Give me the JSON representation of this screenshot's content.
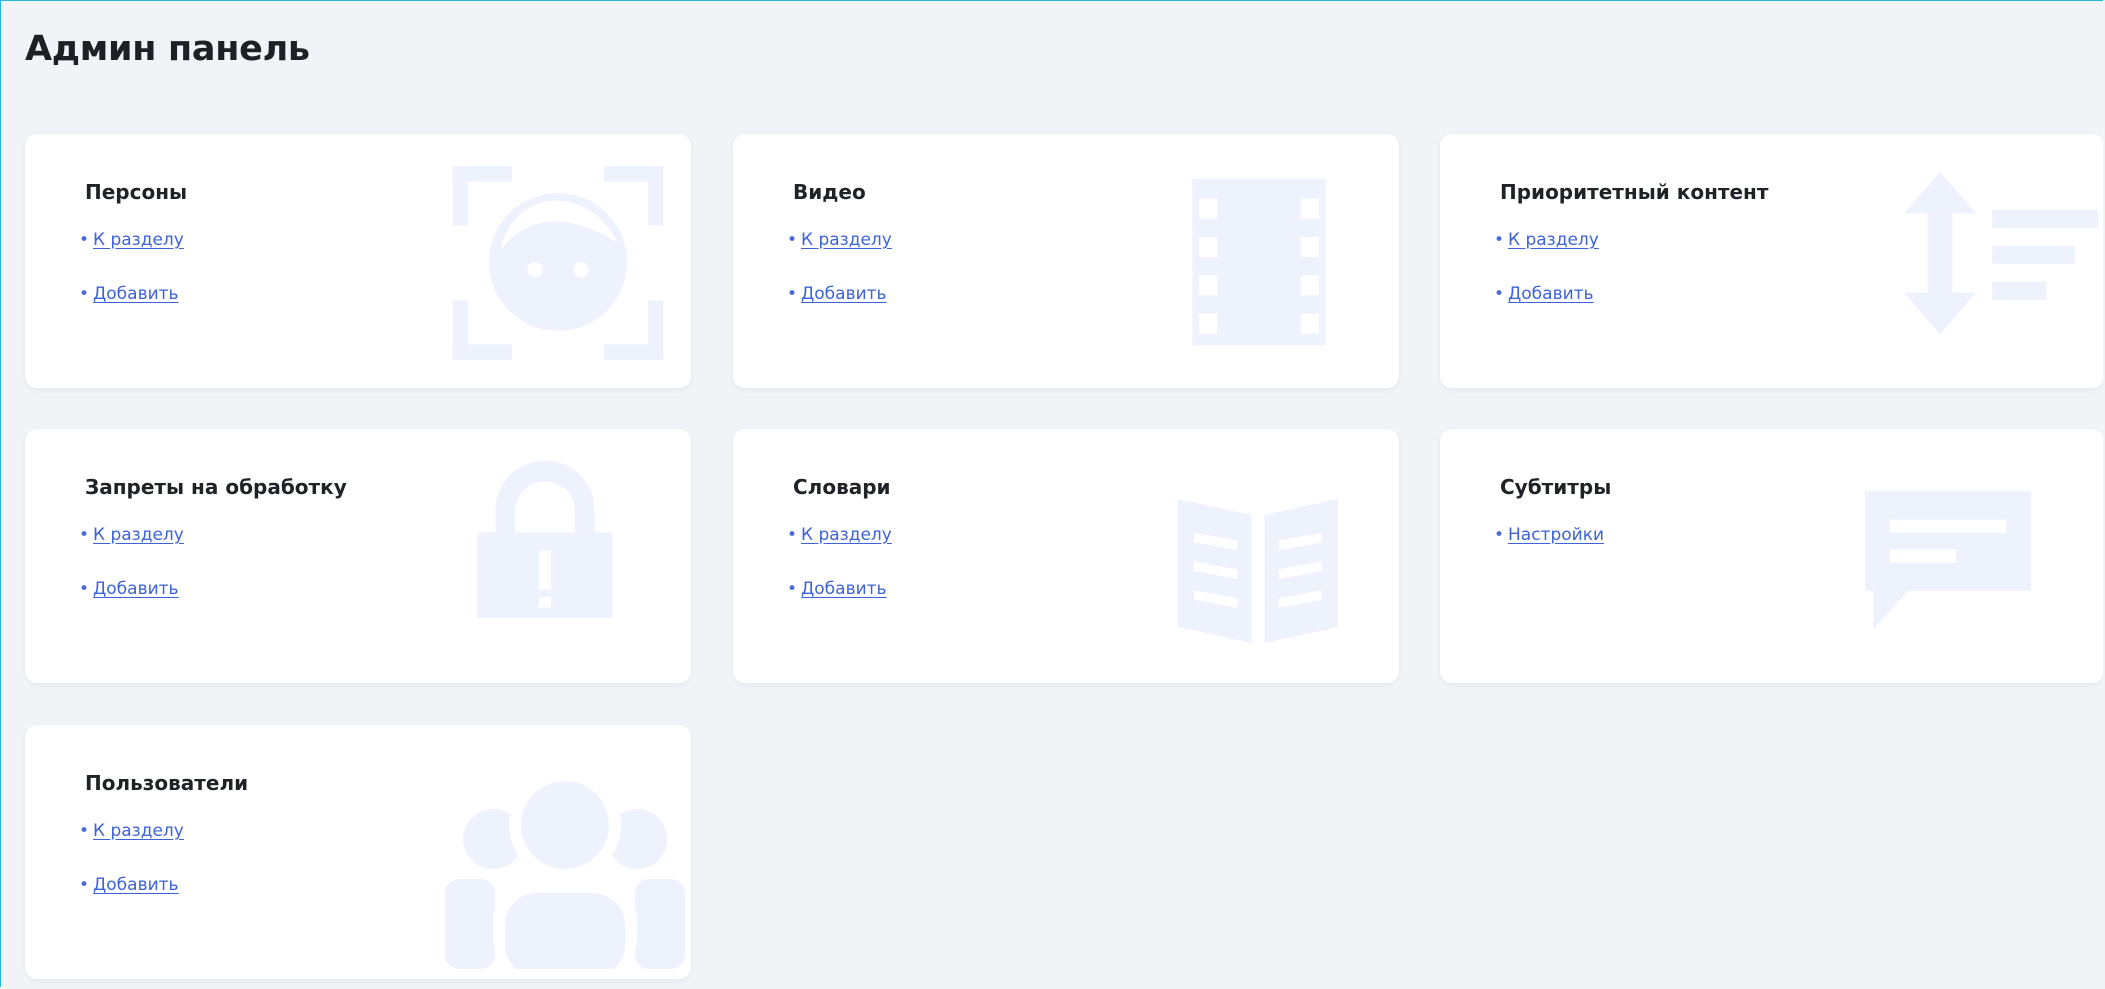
{
  "page": {
    "title": "Админ панель"
  },
  "colors": {
    "accent_link": "#3d63d6",
    "card_background": "#ffffff",
    "page_background": "#f2f3f6",
    "icon_tint": "#eef2fc",
    "frame_border": "#27b6d6"
  },
  "cards": [
    {
      "title": "Персоны",
      "icon": "face-recognition-icon",
      "links": [
        "К разделу",
        "Добавить"
      ]
    },
    {
      "title": "Видео",
      "icon": "film-strip-icon",
      "links": [
        "К разделу",
        "Добавить"
      ]
    },
    {
      "title": "Приоритетный контент",
      "icon": "sort-priority-icon",
      "links": [
        "К разделу",
        "Добавить"
      ]
    },
    {
      "title": "Запреты на обработку",
      "icon": "lock-icon",
      "links": [
        "К разделу",
        "Добавить"
      ]
    },
    {
      "title": "Словари",
      "icon": "open-book-icon",
      "links": [
        "К разделу",
        "Добавить"
      ]
    },
    {
      "title": "Субтитры",
      "icon": "subtitles-chat-icon",
      "links": [
        "Настройки"
      ]
    },
    {
      "title": "Пользователи",
      "icon": "users-icon",
      "links": [
        "К разделу",
        "Добавить"
      ]
    }
  ]
}
